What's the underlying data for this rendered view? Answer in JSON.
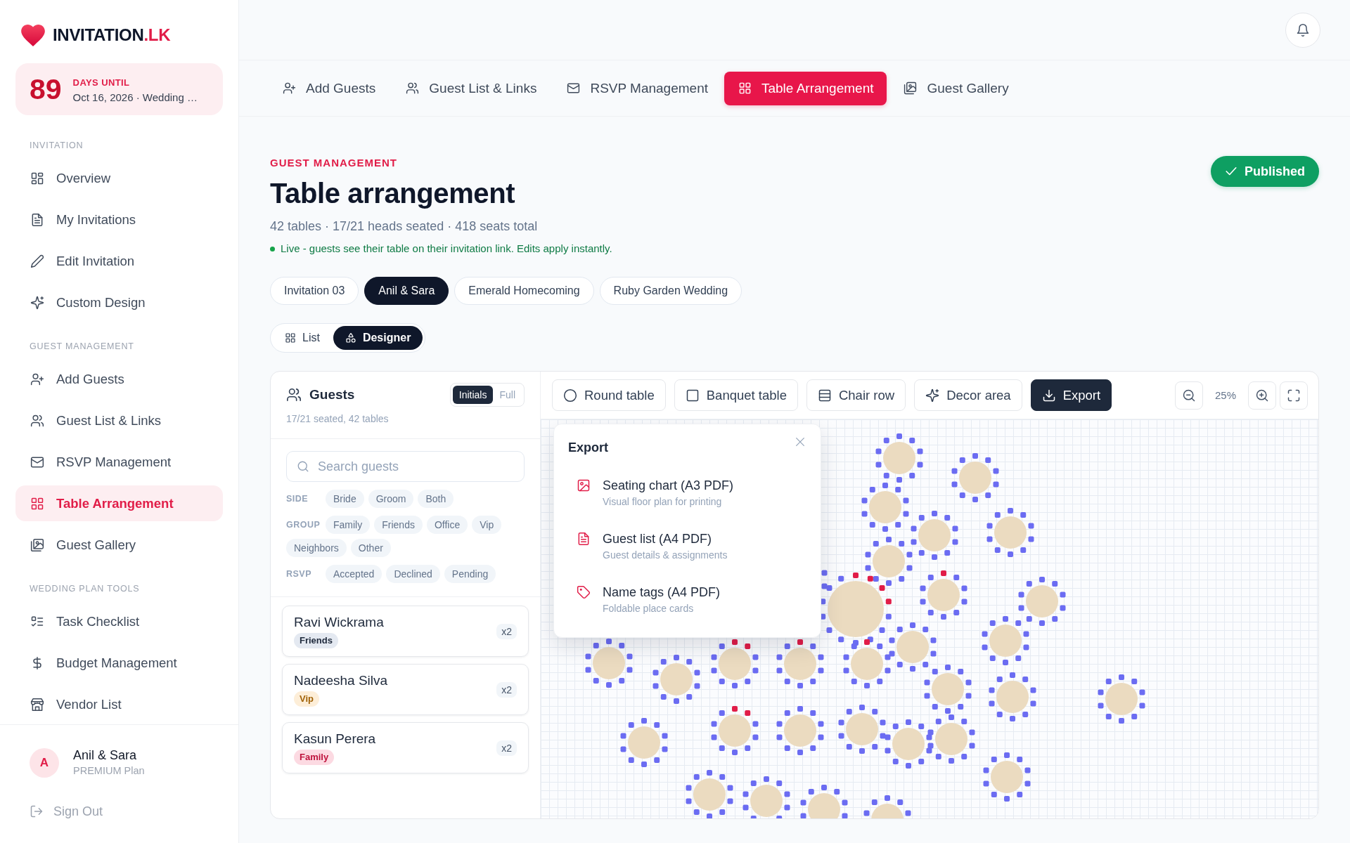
{
  "sidebar": {
    "brand": {
      "name": "INVITATION",
      "suffix": ".LK"
    },
    "countdown": {
      "days": "89",
      "label": "DAYS UNTIL",
      "detail": "Oct 16, 2026 · Wedding …"
    },
    "sections": [
      {
        "title": "INVITATION",
        "items": [
          {
            "label": "Overview",
            "selected": false
          },
          {
            "label": "My Invitations",
            "selected": false
          },
          {
            "label": "Edit Invitation",
            "selected": false
          },
          {
            "label": "Custom Design",
            "selected": false
          }
        ]
      },
      {
        "title": "GUEST MANAGEMENT",
        "items": [
          {
            "label": "Add Guests",
            "selected": false
          },
          {
            "label": "Guest List & Links",
            "selected": false
          },
          {
            "label": "RSVP Management",
            "selected": false
          },
          {
            "label": "Table Arrangement",
            "selected": true
          },
          {
            "label": "Guest Gallery",
            "selected": false
          }
        ]
      },
      {
        "title": "WEDDING PLAN TOOLS",
        "items": [
          {
            "label": "Task Checklist",
            "selected": false
          },
          {
            "label": "Budget Management",
            "selected": false
          },
          {
            "label": "Vendor List",
            "selected": false
          }
        ]
      }
    ],
    "user": {
      "initial": "A",
      "name": "Anil & Sara",
      "plan": "PREMIUM Plan"
    },
    "sign_out": "Sign Out"
  },
  "tabs": [
    {
      "label": "Add Guests",
      "selected": false
    },
    {
      "label": "Guest List & Links",
      "selected": false
    },
    {
      "label": "RSVP Management",
      "selected": false
    },
    {
      "label": "Table Arrangement",
      "selected": true
    },
    {
      "label": "Guest Gallery",
      "selected": false
    }
  ],
  "header": {
    "eyebrow": "GUEST MANAGEMENT",
    "title": "Table arrangement",
    "stats": "42 tables · 17/21 heads seated · 418 seats total",
    "live_note": "Live - guests see their table on their invitation link. Edits apply instantly.",
    "status": "Published"
  },
  "invitations": [
    {
      "label": "Invitation 03",
      "selected": false
    },
    {
      "label": "Anil & Sara",
      "selected": true
    },
    {
      "label": "Emerald Homecoming",
      "selected": false
    },
    {
      "label": "Ruby Garden Wedding",
      "selected": false
    }
  ],
  "views": [
    {
      "label": "List",
      "selected": false
    },
    {
      "label": "Designer",
      "selected": true
    }
  ],
  "guests_panel": {
    "title": "Guests",
    "name_modes": [
      {
        "label": "Initials",
        "selected": true
      },
      {
        "label": "Full",
        "selected": false
      }
    ],
    "summary": "17/21 seated, 42 tables",
    "search": {
      "placeholder": "Search guests"
    },
    "filters": [
      {
        "label": "SIDE",
        "options": [
          {
            "label": "Bride",
            "selected": false
          },
          {
            "label": "Groom",
            "selected": false
          },
          {
            "label": "Both",
            "selected": false
          }
        ]
      },
      {
        "label": "GROUP",
        "options": [
          {
            "label": "Family",
            "selected": false
          },
          {
            "label": "Friends",
            "selected": false
          },
          {
            "label": "Office",
            "selected": false
          },
          {
            "label": "Vip",
            "selected": false
          },
          {
            "label": "Neighbors",
            "selected": false
          },
          {
            "label": "Other",
            "selected": false
          }
        ]
      },
      {
        "label": "RSVP",
        "options": [
          {
            "label": "Accepted",
            "selected": false
          },
          {
            "label": "Declined",
            "selected": false
          },
          {
            "label": "Pending",
            "selected": false
          }
        ]
      }
    ],
    "guests": [
      {
        "name": "Ravi Wickrama",
        "tag": "Friends",
        "color": "#1e293b",
        "count": "x2"
      },
      {
        "name": "Nadeesha Silva",
        "tag": "Vip",
        "color": "#a16207",
        "count": "x2"
      },
      {
        "name": "Kasun Perera",
        "tag": "Family",
        "color": "#be123c",
        "count": "x2"
      }
    ]
  },
  "designer": {
    "tools": [
      "Round table",
      "Banquet table",
      "Chair row",
      "Decor area"
    ],
    "export_button": "Export",
    "zoom": "25%",
    "export_menu": {
      "title": "Export",
      "items": [
        {
          "title": "Seating chart (A3 PDF)",
          "subtitle": "Visual floor plan for printing"
        },
        {
          "title": "Guest list (A4 PDF)",
          "subtitle": "Guest details & assignments"
        },
        {
          "title": "Name tags (A4 PDF)",
          "subtitle": "Foldable place cards"
        }
      ]
    }
  }
}
